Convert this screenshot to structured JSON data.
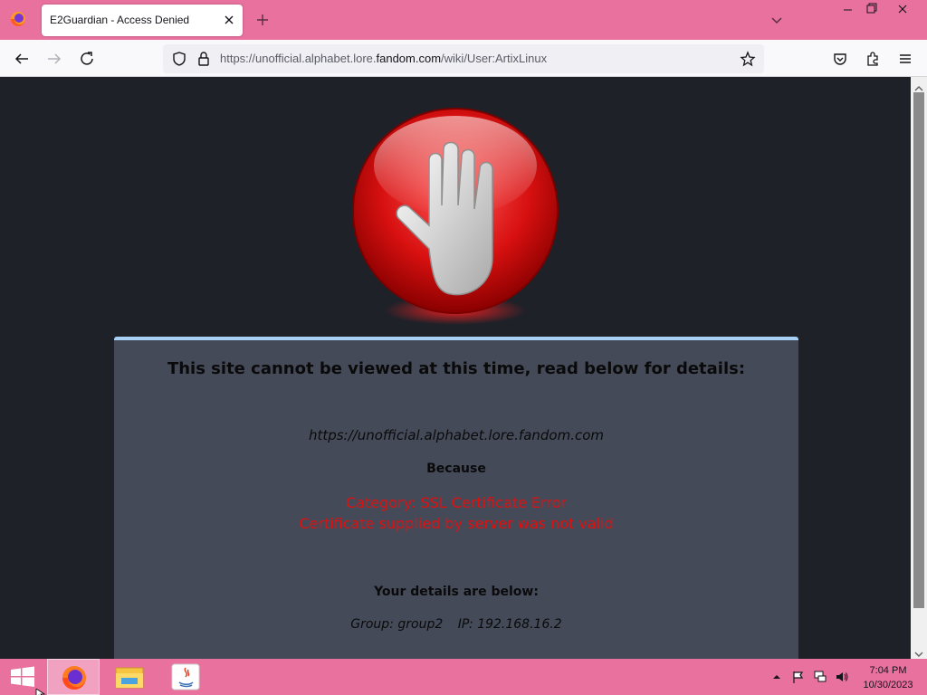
{
  "browser": {
    "tab": {
      "title": "E2Guardian - Access Denied"
    },
    "url": {
      "prefix": "https://unofficial.alphabet.lore.",
      "domain": "fandom.com",
      "suffix": "/wiki/User:ArtixLinux"
    }
  },
  "page": {
    "heading": "This site cannot be viewed at this time, read below for details:",
    "blocked_url": "https://unofficial.alphabet.lore.fandom.com",
    "because": "Because",
    "category": "Category: SSL Certificate Error",
    "reason": "Certificate supplied by server was not valid",
    "details_heading": "Your details are below:",
    "group": "Group: group2",
    "ip": "IP: 192.168.16.2"
  },
  "taskbar": {
    "time": "7:04 PM",
    "date": "10/30/2023"
  },
  "colors": {
    "accent": "#e8719e",
    "error_text": "#e01010",
    "panel_bg": "#454a59",
    "page_bg": "#1f2128"
  },
  "icons": [
    "firefox-icon",
    "close-icon",
    "plus-icon",
    "chevron-down-icon",
    "back-icon",
    "forward-icon",
    "reload-icon",
    "shield-icon",
    "lock-icon",
    "star-icon",
    "pocket-icon",
    "extensions-icon",
    "menu-icon",
    "stop-hand-icon",
    "windows-start-icon",
    "file-explorer-icon",
    "java-icon",
    "flag-icon",
    "network-icon",
    "volume-icon"
  ]
}
